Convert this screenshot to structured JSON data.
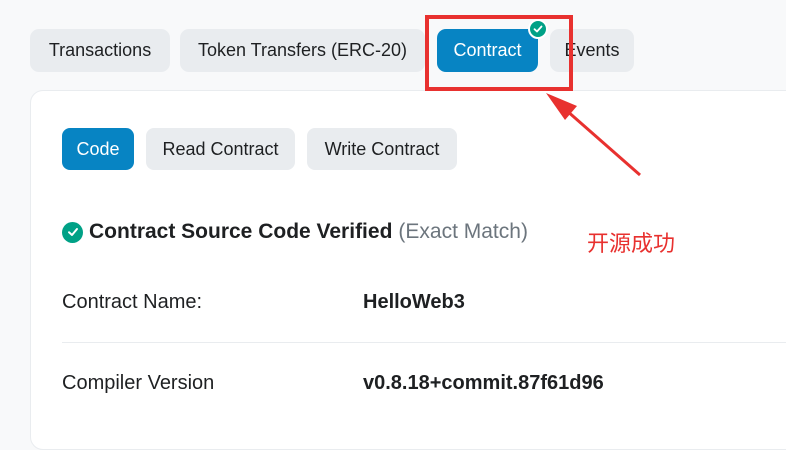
{
  "tabs": [
    {
      "label": "Transactions",
      "active": false
    },
    {
      "label": "Token Transfers (ERC-20)",
      "active": false
    },
    {
      "label": "Contract",
      "active": true
    },
    {
      "label": "Events",
      "active": false
    }
  ],
  "contract_badge_icon": "check-circle-icon",
  "subtabs": [
    {
      "label": "Code",
      "active": true
    },
    {
      "label": "Read Contract",
      "active": false
    },
    {
      "label": "Write Contract",
      "active": false
    }
  ],
  "verification": {
    "icon": "check-circle-icon",
    "title": "Contract Source Code Verified",
    "note": "(Exact Match)"
  },
  "details": [
    {
      "label": "Contract Name:",
      "value": "HelloWeb3"
    },
    {
      "label": "Compiler Version",
      "value": "v0.8.18+commit.87f61d96"
    }
  ],
  "annotation": {
    "text": "开源成功",
    "color": "#e8312f"
  },
  "colors": {
    "accent": "#0784c3",
    "success": "#00a186",
    "annotation_red": "#e8312f"
  }
}
